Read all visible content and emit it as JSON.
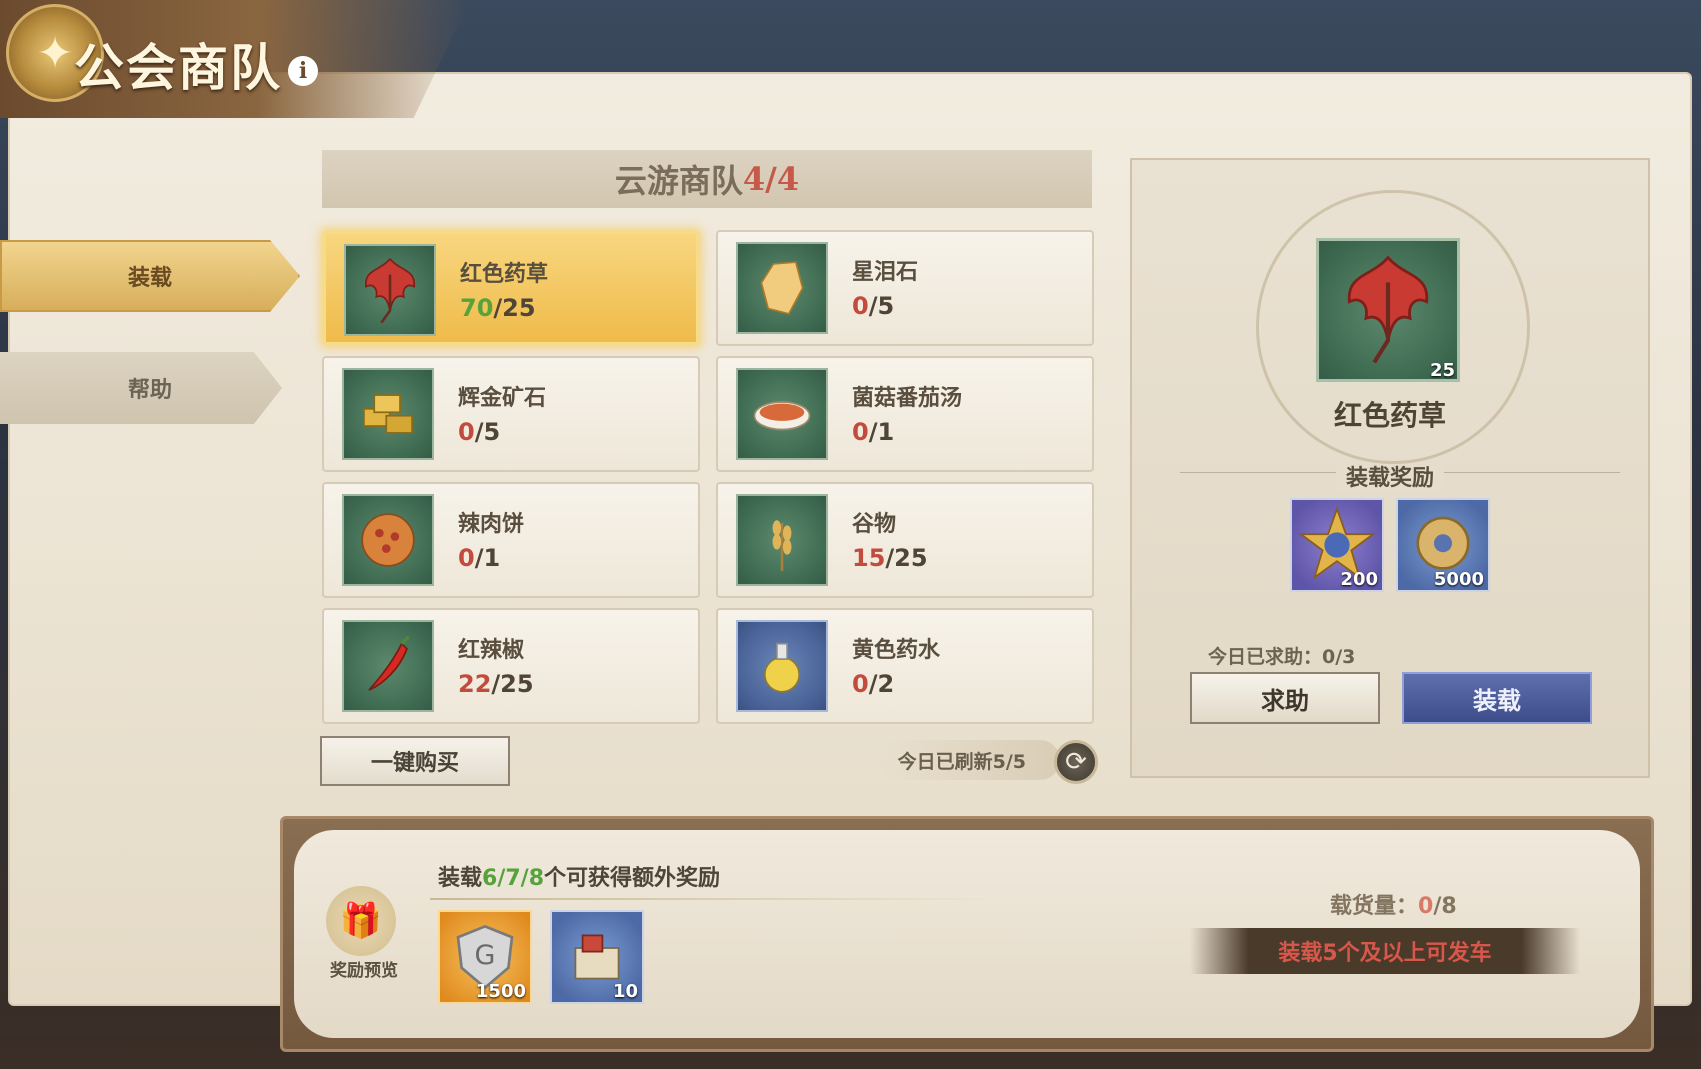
{
  "header": {
    "title": "公会商队",
    "info_glyph": "i"
  },
  "tabs": [
    {
      "label": "装载",
      "active": true
    },
    {
      "label": "帮助",
      "active": false
    }
  ],
  "caravan": {
    "label": "云游商队",
    "count": "4/4"
  },
  "items": [
    {
      "name": "红色药草",
      "have": "70",
      "need": "/25",
      "ok": true,
      "icon": "red-herb-icon",
      "bg": "green",
      "selected": true
    },
    {
      "name": "星泪石",
      "have": "0",
      "need": "/5",
      "ok": false,
      "icon": "star-tear-stone-icon",
      "bg": "green",
      "selected": false
    },
    {
      "name": "辉金矿石",
      "have": "0",
      "need": "/5",
      "ok": false,
      "icon": "gold-ore-icon",
      "bg": "green",
      "selected": false
    },
    {
      "name": "菌菇番茄汤",
      "have": "0",
      "need": "/1",
      "ok": false,
      "icon": "mushroom-tomato-soup-icon",
      "bg": "green",
      "selected": false
    },
    {
      "name": "辣肉饼",
      "have": "0",
      "need": "/1",
      "ok": false,
      "icon": "spicy-meat-pie-icon",
      "bg": "green",
      "selected": false
    },
    {
      "name": "谷物",
      "have": "15",
      "need": "/25",
      "ok": false,
      "icon": "grain-icon",
      "bg": "green",
      "selected": false
    },
    {
      "name": "红辣椒",
      "have": "22",
      "need": "/25",
      "ok": false,
      "icon": "red-pepper-icon",
      "bg": "green",
      "selected": false
    },
    {
      "name": "黄色药水",
      "have": "0",
      "need": "/2",
      "ok": false,
      "icon": "yellow-potion-icon",
      "bg": "blue",
      "selected": false
    }
  ],
  "buttons": {
    "buy_all": "一键购买",
    "help": "求助",
    "load": "装载"
  },
  "refresh": {
    "text": "今日已刷新5/5"
  },
  "detail": {
    "name": "红色药草",
    "count": "25",
    "reward_title": "装载奖励",
    "rewards": [
      {
        "icon": "medal-icon",
        "count": "200"
      },
      {
        "icon": "coin-icon",
        "count": "5000"
      }
    ],
    "help_status": "今日已求助：0/3"
  },
  "bottom": {
    "extra_prefix": "装载",
    "extra_nums": "6/7/8",
    "extra_suffix": "个可获得额外奖励",
    "gift_label": "奖励预览",
    "extra_rewards": [
      {
        "icon": "guild-shield-icon",
        "count": "1500"
      },
      {
        "icon": "supply-crate-icon",
        "count": "10"
      }
    ],
    "cargo_label": "载货量：",
    "cargo_current": "0",
    "cargo_max": "/8",
    "depart_hint": "装载5个及以上可发车"
  },
  "colors": {
    "selected_gold": "#efbb4a",
    "shortfall_red": "#c24b3d",
    "met_green": "#56a33c",
    "load_blue": "#3d4d8c"
  }
}
